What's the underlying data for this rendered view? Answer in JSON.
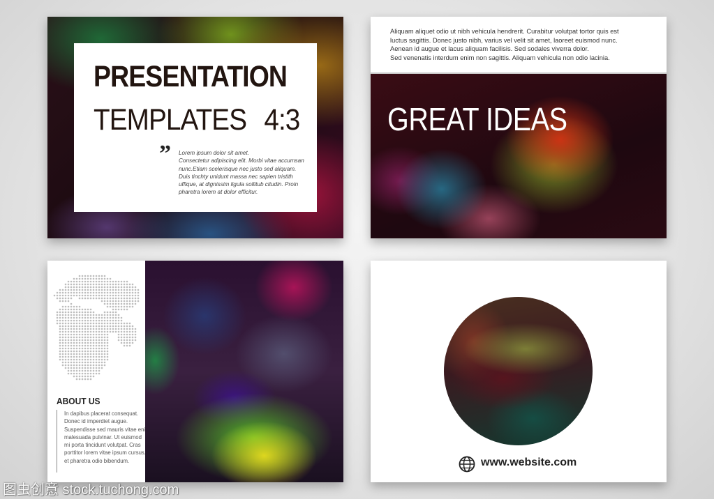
{
  "slide1": {
    "title_line1": "PRESENTATION",
    "title_line2": "TEMPLATES",
    "title_ratio": "4:3",
    "quote_mark": "”",
    "quote_lines": [
      "Lorem ipsum dolor sit amet.",
      "Consectetur adipiscing elit. Morbi vitae accumsan",
      "nunc.Etiam scelerisque nec justo sed aliquam.",
      "Duis tinchty unidunt massa nec sapien tristith",
      "uffique, at dignissim ligula sollitub citudin. Proin",
      "pharetra lorem at dolor efficitur."
    ]
  },
  "slide2": {
    "top_lines": [
      "Aliquam aliquet odio ut nibh vehicula hendrerit. Curabitur volutpat tortor quis est",
      "luctus sagittis. Donec justo nibh, varius vel velit sit amet, laoreet euismod nunc.",
      "Aenean id augue et lacus aliquam facilisis. Sed sodales viverra dolor.",
      "Sed venenatis interdum enim non sagittis. Aliquam vehicula non odio lacinia."
    ],
    "headline": "GREAT IDEAS"
  },
  "slide3": {
    "heading": "ABOUT US",
    "body_lines": [
      "In dapibus placerat consequat.",
      "Donec id imperdiet augue.",
      "Suspendisse sed mauris vitae enim",
      "malesuada pulvinar. Ut euismod",
      "mi porta tincidunt volutpat. Cras",
      "porttitor lorem vitae ipsum cursus,",
      "et pharetra odio bibendum."
    ]
  },
  "slide4": {
    "icon": "globe-icon",
    "website": "www.website.com"
  },
  "watermark": "图虫创意 stock.tuchong.com"
}
